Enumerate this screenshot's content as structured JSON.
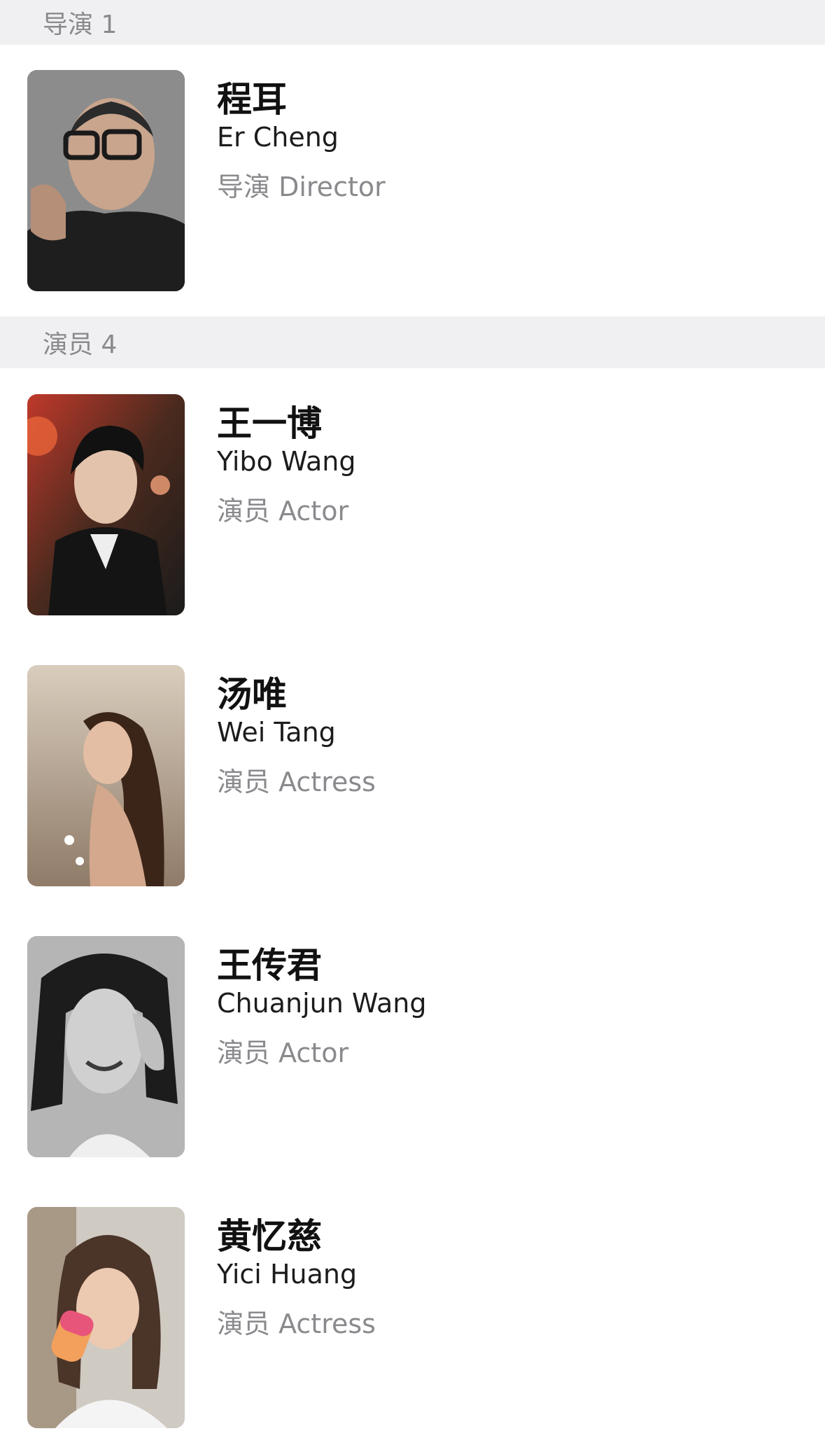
{
  "sections": [
    {
      "header": "导演 1",
      "people": [
        {
          "name_cn": "程耳",
          "name_en": "Er Cheng",
          "role": "导演 Director"
        }
      ]
    },
    {
      "header": "演员 4",
      "people": [
        {
          "name_cn": "王一博",
          "name_en": "Yibo Wang",
          "role": "演员 Actor"
        },
        {
          "name_cn": "汤唯",
          "name_en": "Wei Tang",
          "role": "演员 Actress"
        },
        {
          "name_cn": "王传君",
          "name_en": "Chuanjun Wang",
          "role": "演员 Actor"
        },
        {
          "name_cn": "黄忆慈",
          "name_en": "Yici Huang",
          "role": "演员 Actress"
        }
      ]
    }
  ],
  "colors": {
    "section_bg": "#f0f0f2",
    "secondary_text": "#8a8a8e",
    "primary_text": "#111111"
  }
}
